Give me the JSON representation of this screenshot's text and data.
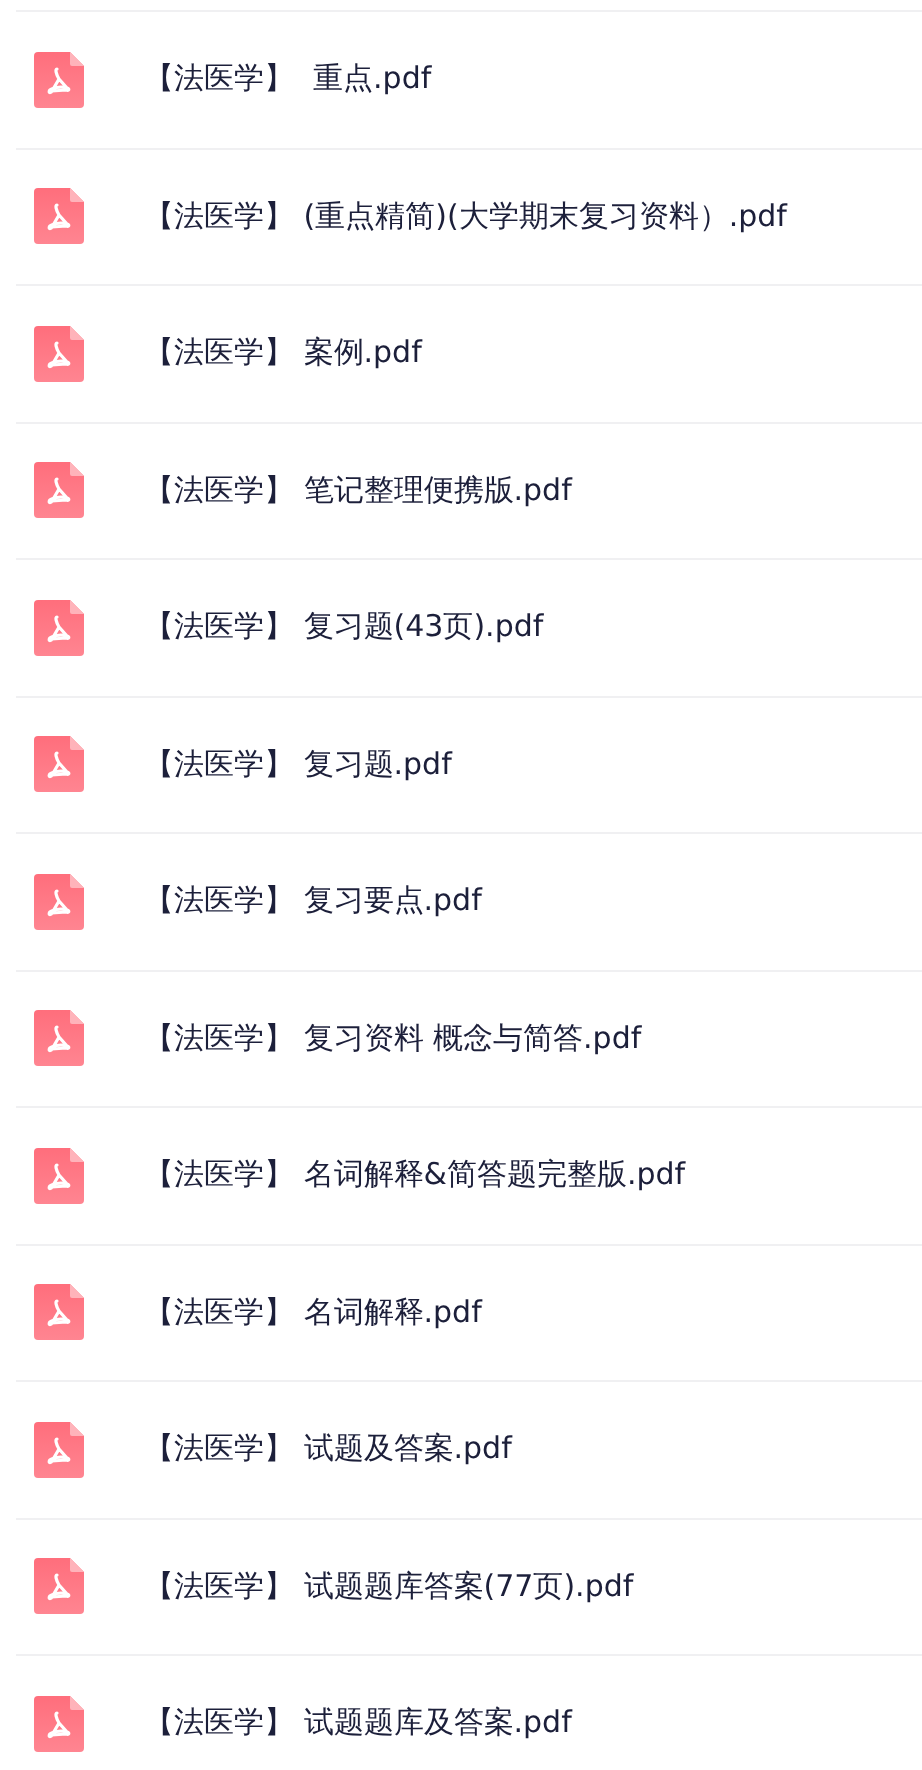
{
  "files": [
    {
      "name": "【法医学】  重点.pdf"
    },
    {
      "name": "【法医学】 (重点精简)(大学期末复习资料）.pdf"
    },
    {
      "name": "【法医学】 案例.pdf"
    },
    {
      "name": "【法医学】 笔记整理便携版.pdf"
    },
    {
      "name": "【法医学】 复习题(43页).pdf"
    },
    {
      "name": "【法医学】 复习题.pdf"
    },
    {
      "name": "【法医学】 复习要点.pdf"
    },
    {
      "name": "【法医学】 复习资料 概念与简答.pdf"
    },
    {
      "name": "【法医学】 名词解释&简答题完整版.pdf"
    },
    {
      "name": "【法医学】 名词解释.pdf"
    },
    {
      "name": "【法医学】 试题及答案.pdf"
    },
    {
      "name": "【法医学】 试题题库答案(77页).pdf"
    },
    {
      "name": "【法医学】 试题题库及答案.pdf"
    }
  ]
}
